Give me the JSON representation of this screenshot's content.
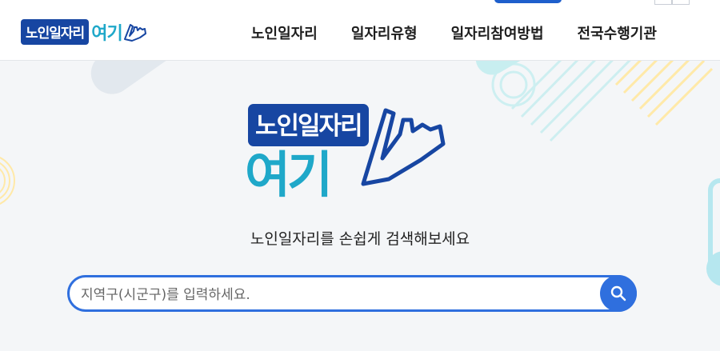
{
  "header": {
    "logo": {
      "box_text": "노인일자리",
      "accent_text": "여기"
    },
    "nav": [
      {
        "label": "노인일자리"
      },
      {
        "label": "일자리유형"
      },
      {
        "label": "일자리참여방법"
      },
      {
        "label": "전국수행기관"
      }
    ]
  },
  "hero": {
    "logo": {
      "box_text": "노인일자리",
      "accent_text": "여기"
    },
    "tagline": "노인일자리를 손쉽게 검색해보세요",
    "search": {
      "placeholder": "지역구(시군구)를 입력하세요.",
      "value": "",
      "button_icon": "search-icon"
    }
  },
  "colors": {
    "brand_navy": "#1746a2",
    "brand_teal": "#1fa8c9",
    "accent_blue": "#2f6fde"
  }
}
